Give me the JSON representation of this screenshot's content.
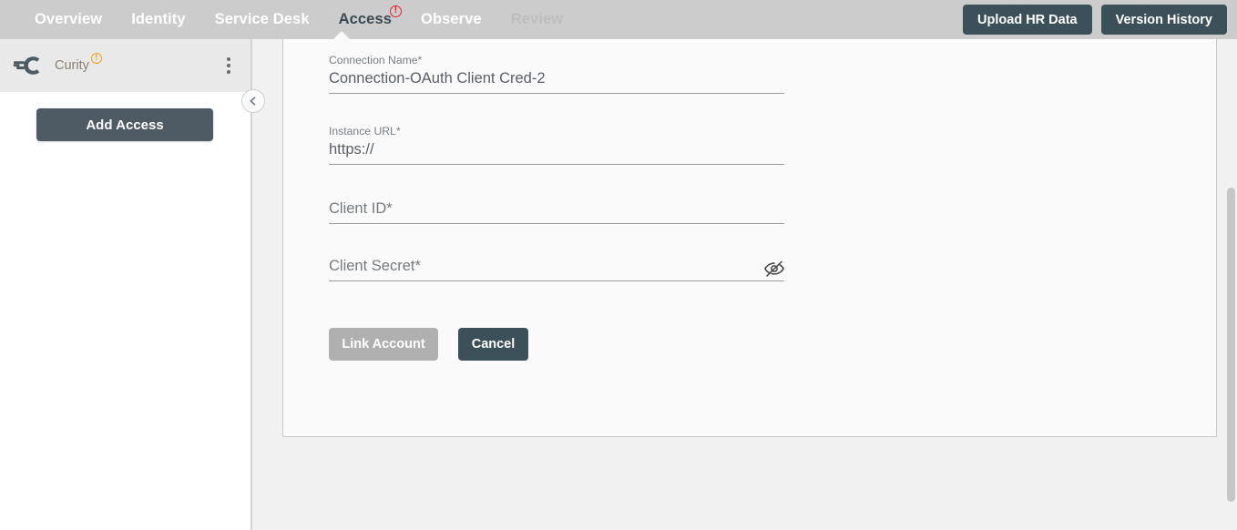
{
  "topnav": {
    "items": [
      {
        "label": "Overview",
        "state": "normal",
        "badge": null
      },
      {
        "label": "Identity",
        "state": "normal",
        "badge": null
      },
      {
        "label": "Service Desk",
        "state": "normal",
        "badge": null
      },
      {
        "label": "Access",
        "state": "active",
        "badge": "!"
      },
      {
        "label": "Observe",
        "state": "normal",
        "badge": null
      },
      {
        "label": "Review",
        "state": "muted",
        "badge": null
      }
    ],
    "upload_hr_data_label": "Upload HR Data",
    "version_history_label": "Version History",
    "background_color": "#cccccc",
    "button_color": "#3b5058",
    "active_color": "#3b4a52",
    "badge_color": "#e8202a"
  },
  "sidebar": {
    "connection": {
      "name": "Curity",
      "logo_icon": "curity-logo-icon",
      "warning_badge": "!",
      "warning_color": "#f0a417",
      "menu_icon": "kebab-menu-icon"
    },
    "add_access_label": "Add Access",
    "collapse_icon": "chevron-left-icon"
  },
  "form": {
    "fields": [
      {
        "label": "Connection Name*",
        "value": "Connection-OAuth Client Cred-2",
        "placeholder": "",
        "filled": true,
        "has_eye_toggle": false
      },
      {
        "label": "Instance URL*",
        "value": "https://",
        "placeholder": "",
        "filled": true,
        "has_eye_toggle": false
      },
      {
        "label": "",
        "value": "",
        "placeholder": "Client ID*",
        "filled": false,
        "has_eye_toggle": false
      },
      {
        "label": "",
        "value": "",
        "placeholder": "Client Secret*",
        "filled": false,
        "has_eye_toggle": true,
        "eye_icon": "eye-off-icon"
      }
    ],
    "link_account_label": "Link Account",
    "link_account_disabled": true,
    "cancel_label": "Cancel"
  }
}
